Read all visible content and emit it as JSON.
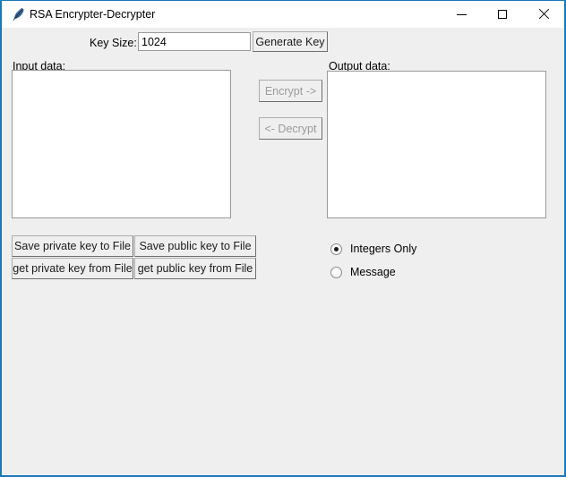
{
  "window": {
    "title": "RSA Encrypter-Decrypter",
    "icon": "feather-icon",
    "accent_color": "#1a79ba",
    "background_color": "#efefef",
    "controls": {
      "minimize": "minimize-icon",
      "maximize": "maximize-icon",
      "close": "close-icon"
    }
  },
  "keyrow": {
    "key_size_label": "Key Size:",
    "key_size_value": "1024",
    "key_size_placeholder": "",
    "generate_key_label": "Generate Key"
  },
  "panels": {
    "input_label": "Input data:",
    "input_value": "",
    "input_placeholder": "",
    "output_label": "Output data:",
    "output_value": "",
    "output_placeholder": ""
  },
  "transfer": {
    "encrypt_label": "Encrypt ->",
    "encrypt_enabled": false,
    "decrypt_label": "<- Decrypt",
    "decrypt_enabled": false
  },
  "keyfile_buttons": [
    {
      "label": "Save private key to File"
    },
    {
      "label": "Save public key to File"
    },
    {
      "label": "get private key from File"
    },
    {
      "label": "get public key from File"
    }
  ],
  "mode": {
    "options": [
      {
        "label": "Integers Only",
        "selected": true
      },
      {
        "label": "Message",
        "selected": false
      }
    ]
  }
}
